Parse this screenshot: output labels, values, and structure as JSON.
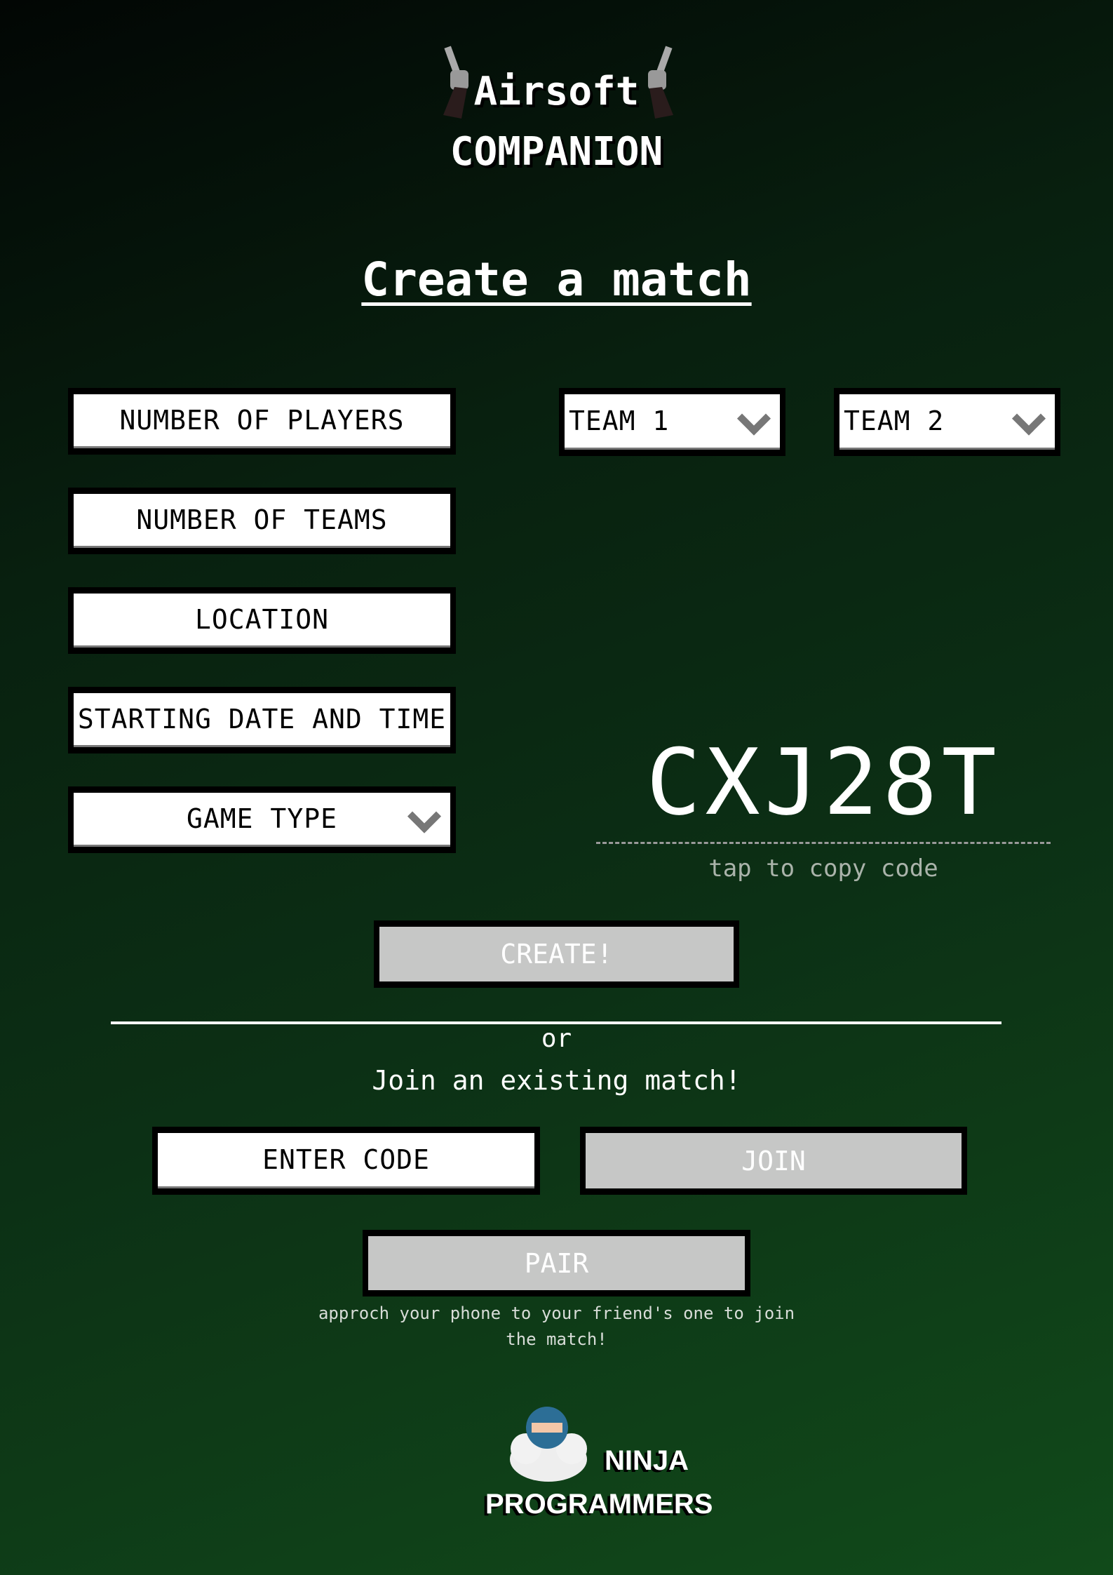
{
  "header": {
    "app_name_line1": "Airsoft",
    "app_name_line2": "COMPANION"
  },
  "page_title": "Create a match",
  "form": {
    "number_of_players": "NUMBER OF PLAYERS",
    "number_of_teams": "NUMBER OF TEAMS",
    "location": "LOCATION",
    "starting_date_time": "STARTING DATE AND TIME",
    "game_type": "GAME TYPE",
    "team1": "TEAM 1",
    "team2": "TEAM 2"
  },
  "match_code": {
    "code": "CXJ28T",
    "hint": "tap to copy code"
  },
  "create_label": "CREATE!",
  "divider_or": "or",
  "join": {
    "heading": "Join an existing match!",
    "code_placeholder": "ENTER CODE",
    "join_label": "JOIN"
  },
  "pair": {
    "label": "PAIR",
    "hint_line1": "approch your phone to your friend's one to join",
    "hint_line2": "the match!"
  },
  "footer": {
    "brand_line1": "NINJA",
    "brand_line2": "PROGRAMMERS"
  }
}
